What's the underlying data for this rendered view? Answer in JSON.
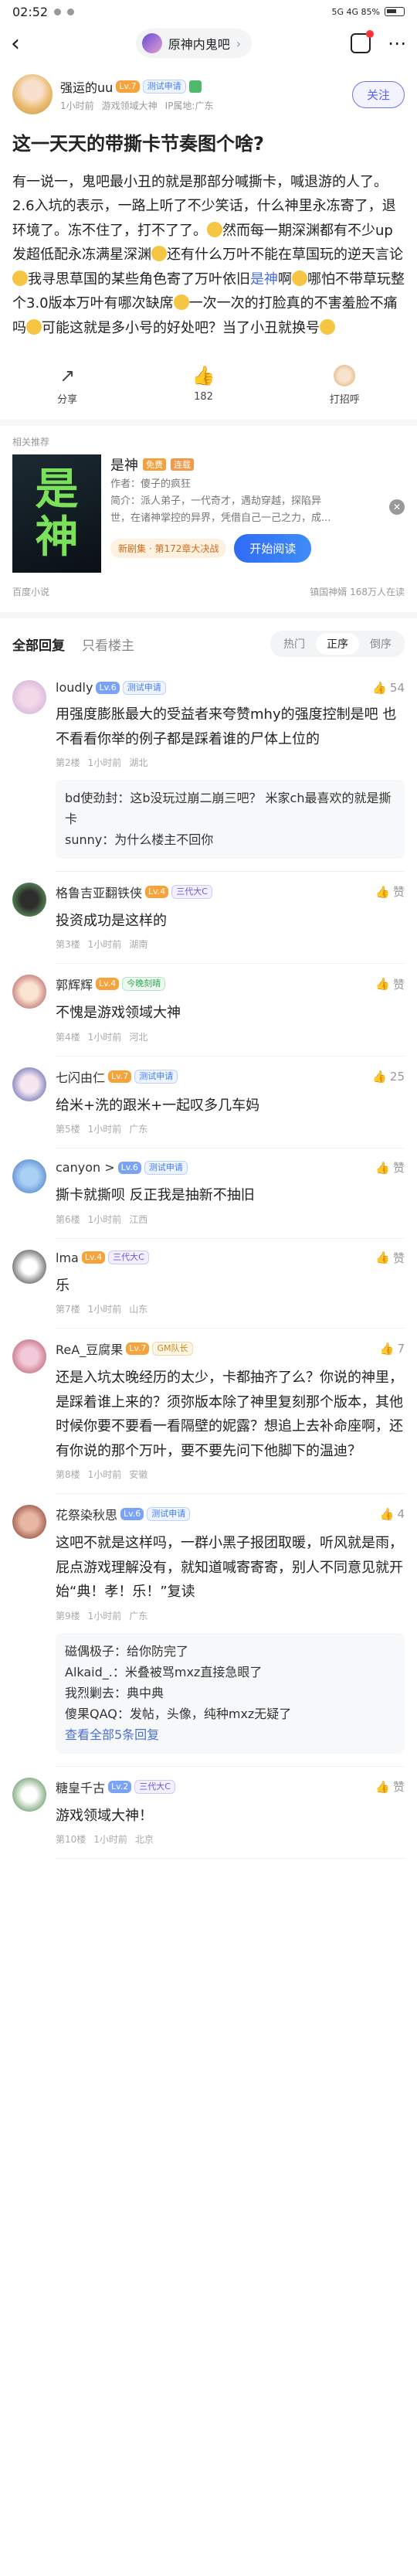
{
  "status": {
    "time": "02:52",
    "right": "5G 4G 85%"
  },
  "nav": {
    "forum_name": "原神内鬼吧"
  },
  "author": {
    "name": "强运的uu",
    "level": "Lv.7",
    "badge": "测试申请",
    "time": "1小时前",
    "field": "游戏领域大神",
    "ip": "IP属地:广东",
    "follow": "关注"
  },
  "post": {
    "title": "这一天天的带撕卡节奏图个啥?",
    "body_1": "有一说一，鬼吧最小丑的就是那部分喊撕卡，喊退游的人了。2.6入坑的表示，一路上听了不少笑话，什么神里永冻寄了，退环境了。冻不住了，打不了了。",
    "body_2": "然而每一期深渊都有不少up发超低配永冻满星深渊",
    "body_3": "还有什么万叶不能在草国玩的逆天言论",
    "body_4": "我寻思草国的某些角色寄了万叶依旧",
    "forum_link": "是神",
    "body_5": "啊",
    "body_6": "哪怕不带草玩整个3.0版本万叶有哪次缺席",
    "body_7": "一次一次的打脸真的不害羞脸不痛吗",
    "body_8": "可能这就是多小号的好处吧？当了小丑就换号"
  },
  "actions": {
    "share": "分享",
    "likes": "182",
    "tip": "打招呼"
  },
  "recommend": {
    "label": "相关推荐",
    "cover_text_1": "是",
    "cover_text_2": "神",
    "title": "是神",
    "badge1": "免费",
    "badge2": "连载",
    "author": "作者：傻子的疯狂",
    "intro_1": "简介：派人弟子，一代奇才，遇劫穿越，探陷异",
    "intro_2": "世，在诸神掌控的异界，凭借自己一己之力，成...",
    "promo": "新剧集 · 第172章大决战",
    "btn": "开始阅读",
    "source": "百度小说",
    "meta": "镇国神婿 168万人在读"
  },
  "comments_header": {
    "tab_all": "全部回复",
    "tab_host": "只看楼主",
    "sort_hot": "热门",
    "sort_asc": "正序",
    "sort_desc": "倒序"
  },
  "comments": [
    {
      "name": "loudly",
      "level": "Lv.6",
      "badge": "测试申请",
      "likes": "54",
      "text": "用强度膨胀最大的受益者来夸赞mhy的强度控制是吧 也不看看你举的例子都是踩着谁的尸体上位的",
      "floor": "第2楼",
      "time": "1小时前",
      "ip": "湖北",
      "replies": [
        "bd使劲封：这b没玩过崩二崩三吧？ 米家ch最喜欢的就是撕卡",
        "sunny：为什么楼主不回你"
      ]
    },
    {
      "name": "格鲁吉亚翻铁侠",
      "level": "Lv.4",
      "badge": "三代大C",
      "likes": "赞",
      "text": "投资成功是这样的",
      "floor": "第3楼",
      "time": "1小时前",
      "ip": "湖南"
    },
    {
      "name": "郭辉辉",
      "level": "Lv.4",
      "badge": "今晚刻晴",
      "likes": "赞",
      "text": "不愧是游戏领域大神",
      "floor": "第4楼",
      "time": "1小时前",
      "ip": "河北"
    },
    {
      "name": "七闪由仁",
      "level": "Lv.7",
      "badge": "测试申请",
      "likes": "25",
      "text": "给米+洗的跟米+一起叹多几车妈",
      "floor": "第5楼",
      "time": "1小时前",
      "ip": "广东"
    },
    {
      "name": "canyon >",
      "level": "Lv.6",
      "badge": "测试申请",
      "likes": "赞",
      "text": "撕卡就撕呗 反正我是抽新不抽旧",
      "floor": "第6楼",
      "time": "1小时前",
      "ip": "江西"
    },
    {
      "name": "lma",
      "level": "Lv.4",
      "badge": "三代大C",
      "likes": "赞",
      "text": "乐",
      "floor": "第7楼",
      "time": "1小时前",
      "ip": "山东"
    },
    {
      "name": "ReA_豆腐果",
      "level": "Lv.7",
      "badge": "GM队长",
      "likes": "7",
      "text": "还是入坑太晚经历的太少，卡都抽齐了么？你说的神里，是踩着谁上来的？须弥版本除了神里复刻那个版本，其他时候你要不要看一看隔壁的妮露？想追上去补命座啊，还有你说的那个万叶，要不要先问下他脚下的温迪？",
      "floor": "第8楼",
      "time": "1小时前",
      "ip": "安徽"
    },
    {
      "name": "花祭染秋思",
      "level": "Lv.6",
      "badge": "测试申请",
      "likes": "4",
      "text": "这吧不就是这样吗，一群小黑子报团取暖，听风就是雨，屁点游戏理解没有，就知道喊寄寄寄，别人不同意见就开始“典！孝！乐！”复读",
      "floor": "第9楼",
      "time": "1小时前",
      "ip": "广东",
      "replies": [
        "磁偶极子：给你防完了",
        "Alkaid_.：米叠被骂mxz直接急眼了",
        "我烈剿去：典中典",
        "傻果QAQ：发帖，头像，纯种mxz无疑了"
      ],
      "more": "查看全部5条回复"
    },
    {
      "name": "糖皇千古",
      "level": "Lv.2",
      "badge": "三代大C",
      "likes": "赞",
      "text": "游戏领域大神！",
      "floor": "第10楼",
      "time": "1小时前",
      "ip": "北京"
    }
  ]
}
